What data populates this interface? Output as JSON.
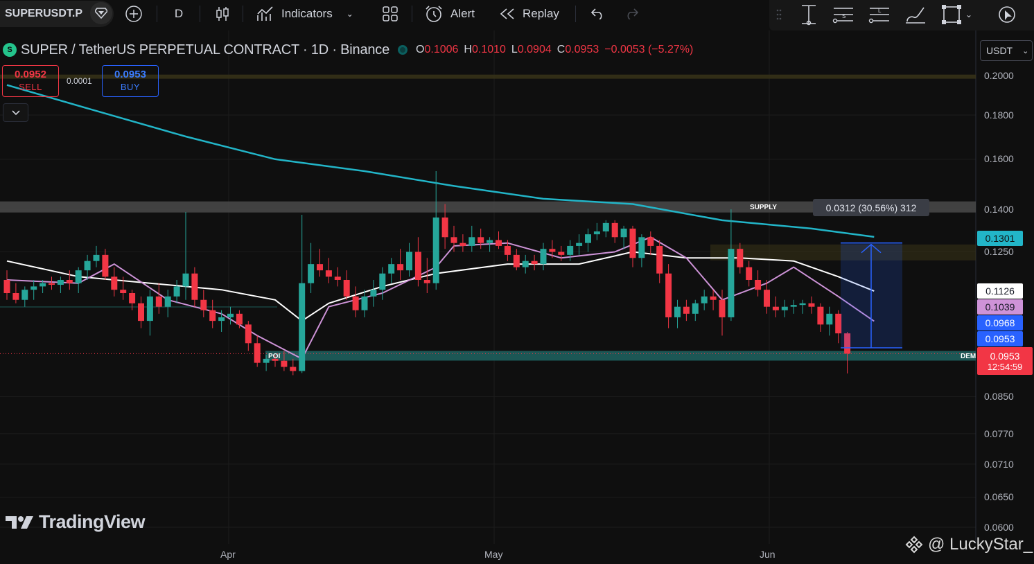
{
  "toolbar": {
    "symbol": "SUPERUSDT.P",
    "interval": "D",
    "indicators_label": "Indicators",
    "alert_label": "Alert",
    "replay_label": "Replay"
  },
  "legend": {
    "title": "SUPER / TetherUS PERPETUAL CONTRACT · 1D · Binance",
    "logo_letter": "S",
    "o_label": "O",
    "o_value": "0.1006",
    "h_label": "H",
    "h_value": "0.1010",
    "l_label": "L",
    "l_value": "0.0904",
    "c_label": "C",
    "c_value": "0.0953",
    "change": "−0.0053 (−5.27%)"
  },
  "trade": {
    "sell_price": "0.0952",
    "sell_label": "SELL",
    "buy_price": "0.0953",
    "buy_label": "BUY",
    "spread": "0.0001"
  },
  "currency": "USDT",
  "price_axis": [
    "0.2000",
    "0.1800",
    "0.1600",
    "0.1400",
    "0.1250",
    "0.0850",
    "0.0770",
    "0.0710",
    "0.0650",
    "0.0600"
  ],
  "price_tags": {
    "ema_slow": "0.1301",
    "sma": "0.1126",
    "ema_fast": "0.1039",
    "measure_start": "0.0968",
    "bid": "0.0953",
    "last": "0.0953",
    "countdown": "12:54:59"
  },
  "time_axis": [
    "Apr",
    "May",
    "Jun"
  ],
  "zones": {
    "supply_label": "SUPPLY",
    "poi_label": "POI",
    "demand_label": "DEM"
  },
  "measure_label": "0.0312 (30.56%) 312",
  "brand": "TradingView",
  "watermark": "@ LuckyStar_",
  "colors": {
    "up": "#26a69a",
    "down": "#f23645",
    "ema_slow": "#22b5c8",
    "ema_fast": "#ce93d8",
    "sma": "#ffffff",
    "accent": "#2962ff"
  },
  "chart_data": {
    "type": "candlestick",
    "title": "SUPER / TetherUS PERPETUAL CONTRACT · 1D · Binance",
    "x_ticks": [
      "Apr",
      "May",
      "Jun"
    ],
    "y_ticks": [
      0.2,
      0.18,
      0.16,
      0.14,
      0.125,
      0.085,
      0.077,
      0.071,
      0.065,
      0.06
    ],
    "y_scale": "log",
    "candles": [
      [
        0.116,
        0.119,
        0.11,
        0.112
      ],
      [
        0.112,
        0.115,
        0.109,
        0.11
      ],
      [
        0.11,
        0.114,
        0.108,
        0.113
      ],
      [
        0.113,
        0.116,
        0.11,
        0.114
      ],
      [
        0.114,
        0.116,
        0.112,
        0.115
      ],
      [
        0.115,
        0.117,
        0.113,
        0.1145
      ],
      [
        0.1145,
        0.117,
        0.112,
        0.116
      ],
      [
        0.116,
        0.119,
        0.113,
        0.115
      ],
      [
        0.115,
        0.12,
        0.112,
        0.119
      ],
      [
        0.119,
        0.124,
        0.116,
        0.122
      ],
      [
        0.122,
        0.127,
        0.12,
        0.124
      ],
      [
        0.124,
        0.126,
        0.116,
        0.117
      ],
      [
        0.117,
        0.12,
        0.111,
        0.113
      ],
      [
        0.113,
        0.117,
        0.11,
        0.112
      ],
      [
        0.112,
        0.113,
        0.107,
        0.109
      ],
      [
        0.109,
        0.111,
        0.102,
        0.104
      ],
      [
        0.104,
        0.113,
        0.1,
        0.111
      ],
      [
        0.111,
        0.115,
        0.106,
        0.108
      ],
      [
        0.108,
        0.113,
        0.105,
        0.111
      ],
      [
        0.111,
        0.116,
        0.109,
        0.114
      ],
      [
        0.114,
        0.139,
        0.11,
        0.118
      ],
      [
        0.118,
        0.12,
        0.108,
        0.11
      ],
      [
        0.11,
        0.113,
        0.105,
        0.107
      ],
      [
        0.107,
        0.11,
        0.102,
        0.104
      ],
      [
        0.104,
        0.107,
        0.101,
        0.105
      ],
      [
        0.105,
        0.108,
        0.103,
        0.106
      ],
      [
        0.106,
        0.107,
        0.102,
        0.103
      ],
      [
        0.103,
        0.104,
        0.096,
        0.098
      ],
      [
        0.098,
        0.1,
        0.092,
        0.093
      ],
      [
        0.093,
        0.095,
        0.091,
        0.094
      ],
      [
        0.094,
        0.095,
        0.092,
        0.0935
      ],
      [
        0.0935,
        0.096,
        0.091,
        0.092
      ],
      [
        0.092,
        0.094,
        0.09,
        0.091
      ],
      [
        0.091,
        0.138,
        0.0905,
        0.115
      ],
      [
        0.115,
        0.128,
        0.112,
        0.121
      ],
      [
        0.121,
        0.126,
        0.117,
        0.119
      ],
      [
        0.119,
        0.123,
        0.115,
        0.117
      ],
      [
        0.117,
        0.12,
        0.114,
        0.116
      ],
      [
        0.116,
        0.119,
        0.11,
        0.111
      ],
      [
        0.111,
        0.114,
        0.105,
        0.107
      ],
      [
        0.107,
        0.113,
        0.105,
        0.111
      ],
      [
        0.111,
        0.116,
        0.108,
        0.113
      ],
      [
        0.113,
        0.12,
        0.11,
        0.118
      ],
      [
        0.118,
        0.123,
        0.115,
        0.121
      ],
      [
        0.121,
        0.126,
        0.116,
        0.119
      ],
      [
        0.119,
        0.128,
        0.117,
        0.125
      ],
      [
        0.125,
        0.13,
        0.114,
        0.116
      ],
      [
        0.116,
        0.123,
        0.112,
        0.115
      ],
      [
        0.115,
        0.155,
        0.113,
        0.137
      ],
      [
        0.137,
        0.142,
        0.126,
        0.13
      ],
      [
        0.13,
        0.134,
        0.125,
        0.128
      ],
      [
        0.128,
        0.131,
        0.125,
        0.127
      ],
      [
        0.127,
        0.134,
        0.125,
        0.13
      ],
      [
        0.13,
        0.133,
        0.126,
        0.128
      ],
      [
        0.128,
        0.13,
        0.125,
        0.129
      ],
      [
        0.129,
        0.132,
        0.126,
        0.127
      ],
      [
        0.127,
        0.129,
        0.122,
        0.124
      ],
      [
        0.124,
        0.126,
        0.119,
        0.12
      ],
      [
        0.12,
        0.124,
        0.118,
        0.122
      ],
      [
        0.122,
        0.124,
        0.119,
        0.121
      ],
      [
        0.121,
        0.128,
        0.119,
        0.126
      ],
      [
        0.126,
        0.129,
        0.123,
        0.125
      ],
      [
        0.125,
        0.127,
        0.122,
        0.124
      ],
      [
        0.124,
        0.129,
        0.122,
        0.127
      ],
      [
        0.127,
        0.131,
        0.124,
        0.128
      ],
      [
        0.128,
        0.133,
        0.125,
        0.131
      ],
      [
        0.131,
        0.135,
        0.129,
        0.132
      ],
      [
        0.132,
        0.136,
        0.13,
        0.135
      ],
      [
        0.135,
        0.136,
        0.128,
        0.13
      ],
      [
        0.13,
        0.134,
        0.126,
        0.133
      ],
      [
        0.133,
        0.134,
        0.12,
        0.123
      ],
      [
        0.123,
        0.131,
        0.12,
        0.13
      ],
      [
        0.13,
        0.132,
        0.124,
        0.127
      ],
      [
        0.127,
        0.129,
        0.115,
        0.118
      ],
      [
        0.118,
        0.121,
        0.102,
        0.105
      ],
      [
        0.105,
        0.11,
        0.102,
        0.108
      ],
      [
        0.108,
        0.11,
        0.104,
        0.106
      ],
      [
        0.106,
        0.11,
        0.104,
        0.109
      ],
      [
        0.109,
        0.113,
        0.107,
        0.111
      ],
      [
        0.111,
        0.113,
        0.107,
        0.11
      ],
      [
        0.11,
        0.113,
        0.1,
        0.105
      ],
      [
        0.105,
        0.14,
        0.104,
        0.126
      ],
      [
        0.126,
        0.128,
        0.118,
        0.12
      ],
      [
        0.12,
        0.122,
        0.114,
        0.116
      ],
      [
        0.116,
        0.119,
        0.111,
        0.113
      ],
      [
        0.113,
        0.116,
        0.106,
        0.108
      ],
      [
        0.108,
        0.111,
        0.105,
        0.107
      ],
      [
        0.107,
        0.11,
        0.105,
        0.108
      ],
      [
        0.108,
        0.11,
        0.106,
        0.1085
      ],
      [
        0.1085,
        0.11,
        0.106,
        0.109
      ],
      [
        0.109,
        0.111,
        0.106,
        0.108
      ],
      [
        0.108,
        0.109,
        0.101,
        0.103
      ],
      [
        0.103,
        0.108,
        0.1,
        0.106
      ],
      [
        0.106,
        0.107,
        0.098,
        0.1006
      ],
      [
        0.1006,
        0.101,
        0.0904,
        0.0953
      ]
    ],
    "ema_slow": [
      [
        0,
        0.195
      ],
      [
        10,
        0.182
      ],
      [
        20,
        0.17
      ],
      [
        30,
        0.16
      ],
      [
        40,
        0.155
      ],
      [
        50,
        0.149
      ],
      [
        60,
        0.144
      ],
      [
        70,
        0.142
      ],
      [
        80,
        0.136
      ],
      [
        90,
        0.133
      ],
      [
        97,
        0.1301
      ]
    ],
    "sma": [
      [
        0,
        0.122
      ],
      [
        8,
        0.117
      ],
      [
        16,
        0.115
      ],
      [
        24,
        0.113
      ],
      [
        30,
        0.11
      ],
      [
        33,
        0.104
      ],
      [
        36,
        0.109
      ],
      [
        42,
        0.114
      ],
      [
        48,
        0.118
      ],
      [
        56,
        0.121
      ],
      [
        64,
        0.121
      ],
      [
        70,
        0.125
      ],
      [
        76,
        0.123
      ],
      [
        82,
        0.123
      ],
      [
        88,
        0.122
      ],
      [
        93,
        0.117
      ],
      [
        97,
        0.1126
      ]
    ],
    "ema_fast": [
      [
        0,
        0.116
      ],
      [
        8,
        0.115
      ],
      [
        12,
        0.121
      ],
      [
        18,
        0.11
      ],
      [
        24,
        0.106
      ],
      [
        28,
        0.1
      ],
      [
        33,
        0.094
      ],
      [
        36,
        0.108
      ],
      [
        42,
        0.112
      ],
      [
        48,
        0.12
      ],
      [
        50,
        0.127
      ],
      [
        56,
        0.128
      ],
      [
        62,
        0.123
      ],
      [
        68,
        0.125
      ],
      [
        72,
        0.13
      ],
      [
        76,
        0.123
      ],
      [
        80,
        0.11
      ],
      [
        85,
        0.115
      ],
      [
        88,
        0.12
      ],
      [
        93,
        0.111
      ],
      [
        97,
        0.1039
      ]
    ]
  }
}
